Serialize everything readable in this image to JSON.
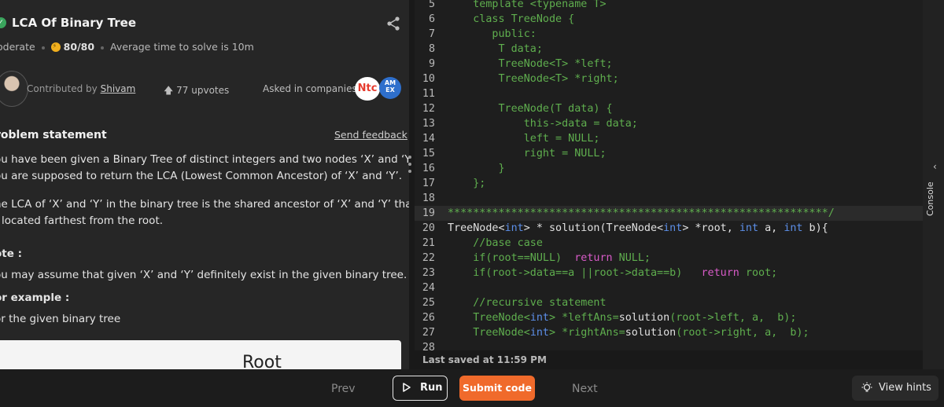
{
  "problem": {
    "title": "LCA Of Binary Tree",
    "difficulty": "oderate",
    "score": "80/80",
    "avg_time": "Average time to solve is 10m",
    "contributed_by_prefix": "Contributed by",
    "contributor": "Shivam",
    "upvotes": "77 upvotes",
    "asked_in": "Asked in companies",
    "company_logo_1": "Ntc",
    "company_logo_2": "AM EX",
    "statement_title": "roblem statement",
    "send_feedback": "Send feedback",
    "para1_line1": "ou have been given a Binary Tree of distinct integers and two nodes ‘X’ and ‘Y’.",
    "para1_line2": "ou are supposed to return the LCA (Lowest Common Ancestor) of ‘X’ and ‘Y’.",
    "para2_line1": "he LCA of ‘X’ and ‘Y’ in the binary tree is the shared ancestor of ‘X’ and ‘Y’ that",
    "para2_line2": "located farthest from the root.",
    "note_title": "ote :",
    "note_text": "ou may assume that given ‘X’ and ‘Y’ definitely exist in the given binary tree.",
    "example_title": "or example :",
    "example_text": "or the given binary tree",
    "image_root_label": "Root"
  },
  "editor": {
    "lines": [
      {
        "n": "5",
        "code": "    template <typename T>"
      },
      {
        "n": "6",
        "code": "    class TreeNode {"
      },
      {
        "n": "7",
        "code": "       public:"
      },
      {
        "n": "8",
        "code": "        T data;"
      },
      {
        "n": "9",
        "code": "        TreeNode<T> *left;"
      },
      {
        "n": "10",
        "code": "        TreeNode<T> *right;"
      },
      {
        "n": "11",
        "code": ""
      },
      {
        "n": "12",
        "code": "        TreeNode(T data) {"
      },
      {
        "n": "13",
        "code": "            this->data = data;"
      },
      {
        "n": "14",
        "code": "            left = NULL;"
      },
      {
        "n": "15",
        "code": "            right = NULL;"
      },
      {
        "n": "16",
        "code": "        }"
      },
      {
        "n": "17",
        "code": "    };"
      },
      {
        "n": "18",
        "code": ""
      },
      {
        "n": "19",
        "code": "************************************************************/"
      },
      {
        "n": "20",
        "code": "TreeNode<int> * solution(TreeNode<int> *root, int a, int b){"
      },
      {
        "n": "21",
        "code": "    //base case"
      },
      {
        "n": "22",
        "code": "    if(root==NULL)  return NULL;"
      },
      {
        "n": "23",
        "code": "    if(root->data==a ||root->data==b)   return root;"
      },
      {
        "n": "24",
        "code": ""
      },
      {
        "n": "25",
        "code": "    //recursive statement"
      },
      {
        "n": "26",
        "code": "    TreeNode<int> *leftAns=solution(root->left, a,  b);"
      },
      {
        "n": "27",
        "code": "    TreeNode<int> *rightAns=solution(root->right, a,  b);"
      },
      {
        "n": "28",
        "code": ""
      }
    ],
    "last_saved": "Last saved at 11:59 PM"
  },
  "console": {
    "label": "Console"
  },
  "bottom": {
    "prev": "Prev",
    "run": "Run",
    "submit": "Submit code",
    "next": "Next",
    "hints": "View hints"
  },
  "colors": {
    "accent_orange": "#f06a2b",
    "keyword_blue": "#5c8fe8",
    "code_green": "#5fae4e",
    "keyword_magenta": "#d85bc8"
  }
}
